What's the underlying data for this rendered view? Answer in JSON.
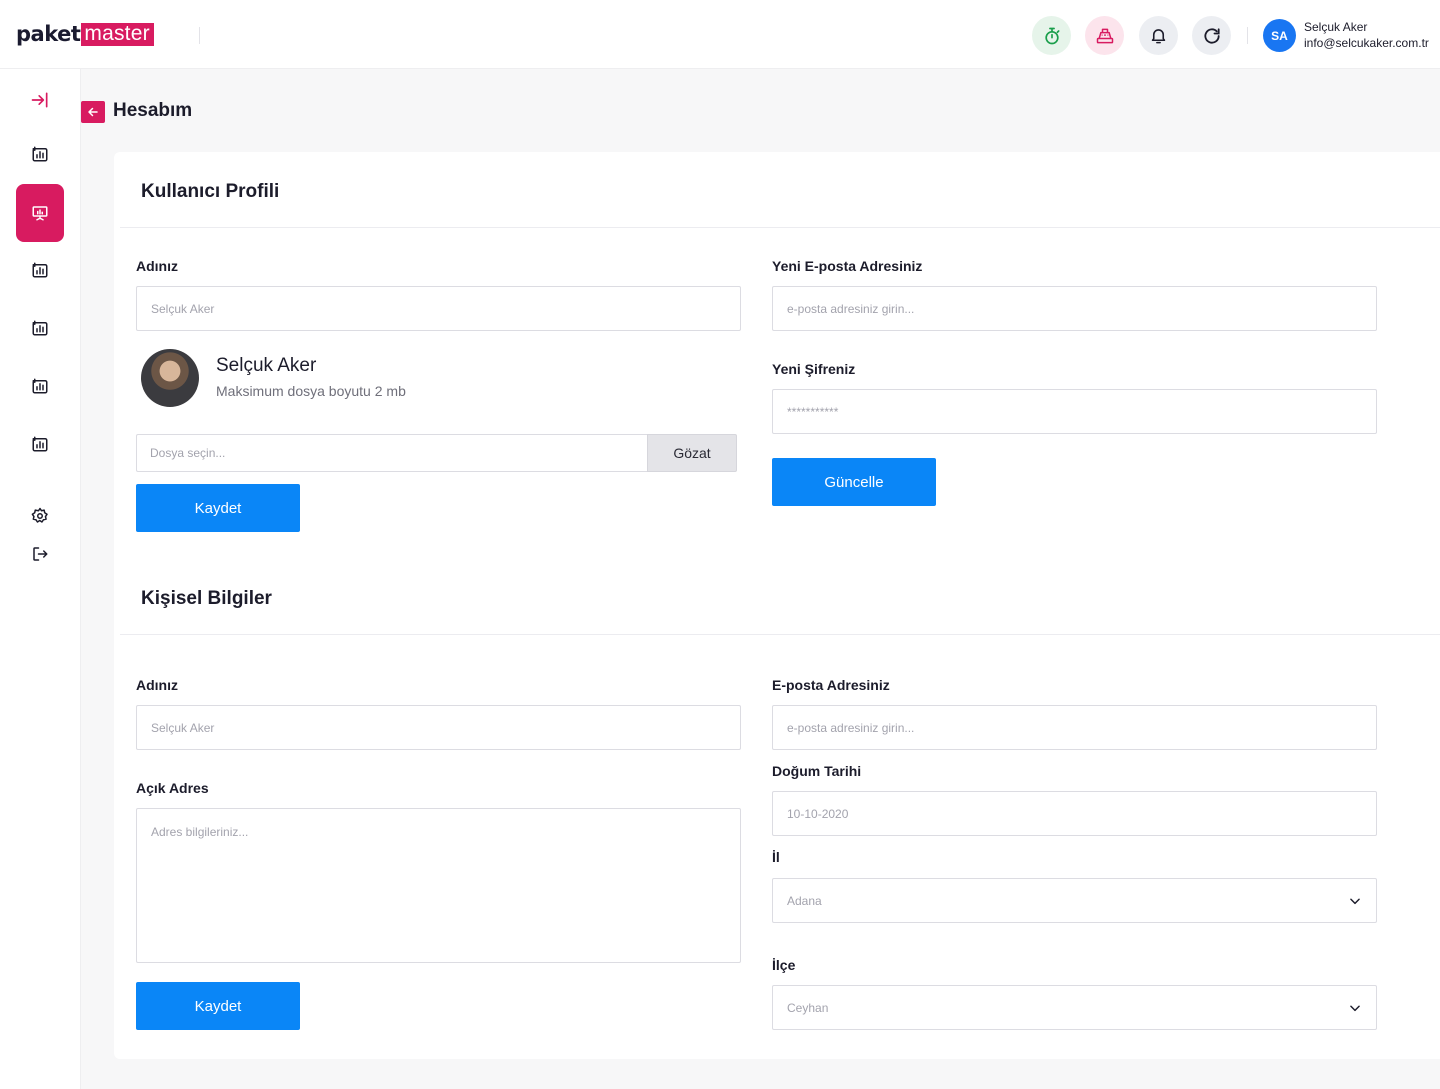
{
  "header": {
    "logo_part1": "paket",
    "logo_part2": "master",
    "user_initials": "SA",
    "user_name": "Selçuk Aker",
    "user_email": "info@selcukaker.com.tr"
  },
  "sidebar": {
    "items": [
      {
        "icon": "expand-sidebar-icon"
      },
      {
        "icon": "chart-icon"
      },
      {
        "icon": "presentation-icon",
        "active": true
      },
      {
        "icon": "chart-icon"
      },
      {
        "icon": "chart-icon"
      },
      {
        "icon": "chart-icon"
      },
      {
        "icon": "chart-icon"
      },
      {
        "icon": "settings-icon"
      },
      {
        "icon": "logout-icon"
      }
    ]
  },
  "page": {
    "title": "Hesabım"
  },
  "profile": {
    "section_title": "Kullanıcı Profili",
    "name_label": "Adınız",
    "name_placeholder": "Selçuk Aker",
    "photo_name": "Selçuk Aker",
    "photo_hint": "Maksimum dosya boyutu 2 mb",
    "file_placeholder": "Dosya seçin...",
    "browse_label": "Gözat",
    "save_label": "Kaydet",
    "new_email_label": "Yeni E-posta Adresiniz",
    "new_email_placeholder": "e-posta adresiniz girin...",
    "new_password_label": "Yeni Şifreniz",
    "new_password_placeholder": "***********",
    "update_label": "Güncelle"
  },
  "personal": {
    "section_title": "Kişisel Bilgiler",
    "name_label": "Adınız",
    "name_placeholder": "Selçuk Aker",
    "address_label": "Açık Adres",
    "address_placeholder": "Adres bilgileriniz...",
    "save_label": "Kaydet",
    "email_label": "E-posta Adresiniz",
    "email_placeholder": "e-posta adresiniz girin...",
    "birth_label": "Doğum Tarihi",
    "birth_placeholder": "10-10-2020",
    "city_label": "İl",
    "city_value": "Adana",
    "district_label": "İlçe",
    "district_value": "Ceyhan"
  },
  "colors": {
    "brand": "#d81b60",
    "primary_button": "#0a86f7",
    "avatar": "#1976f2"
  }
}
